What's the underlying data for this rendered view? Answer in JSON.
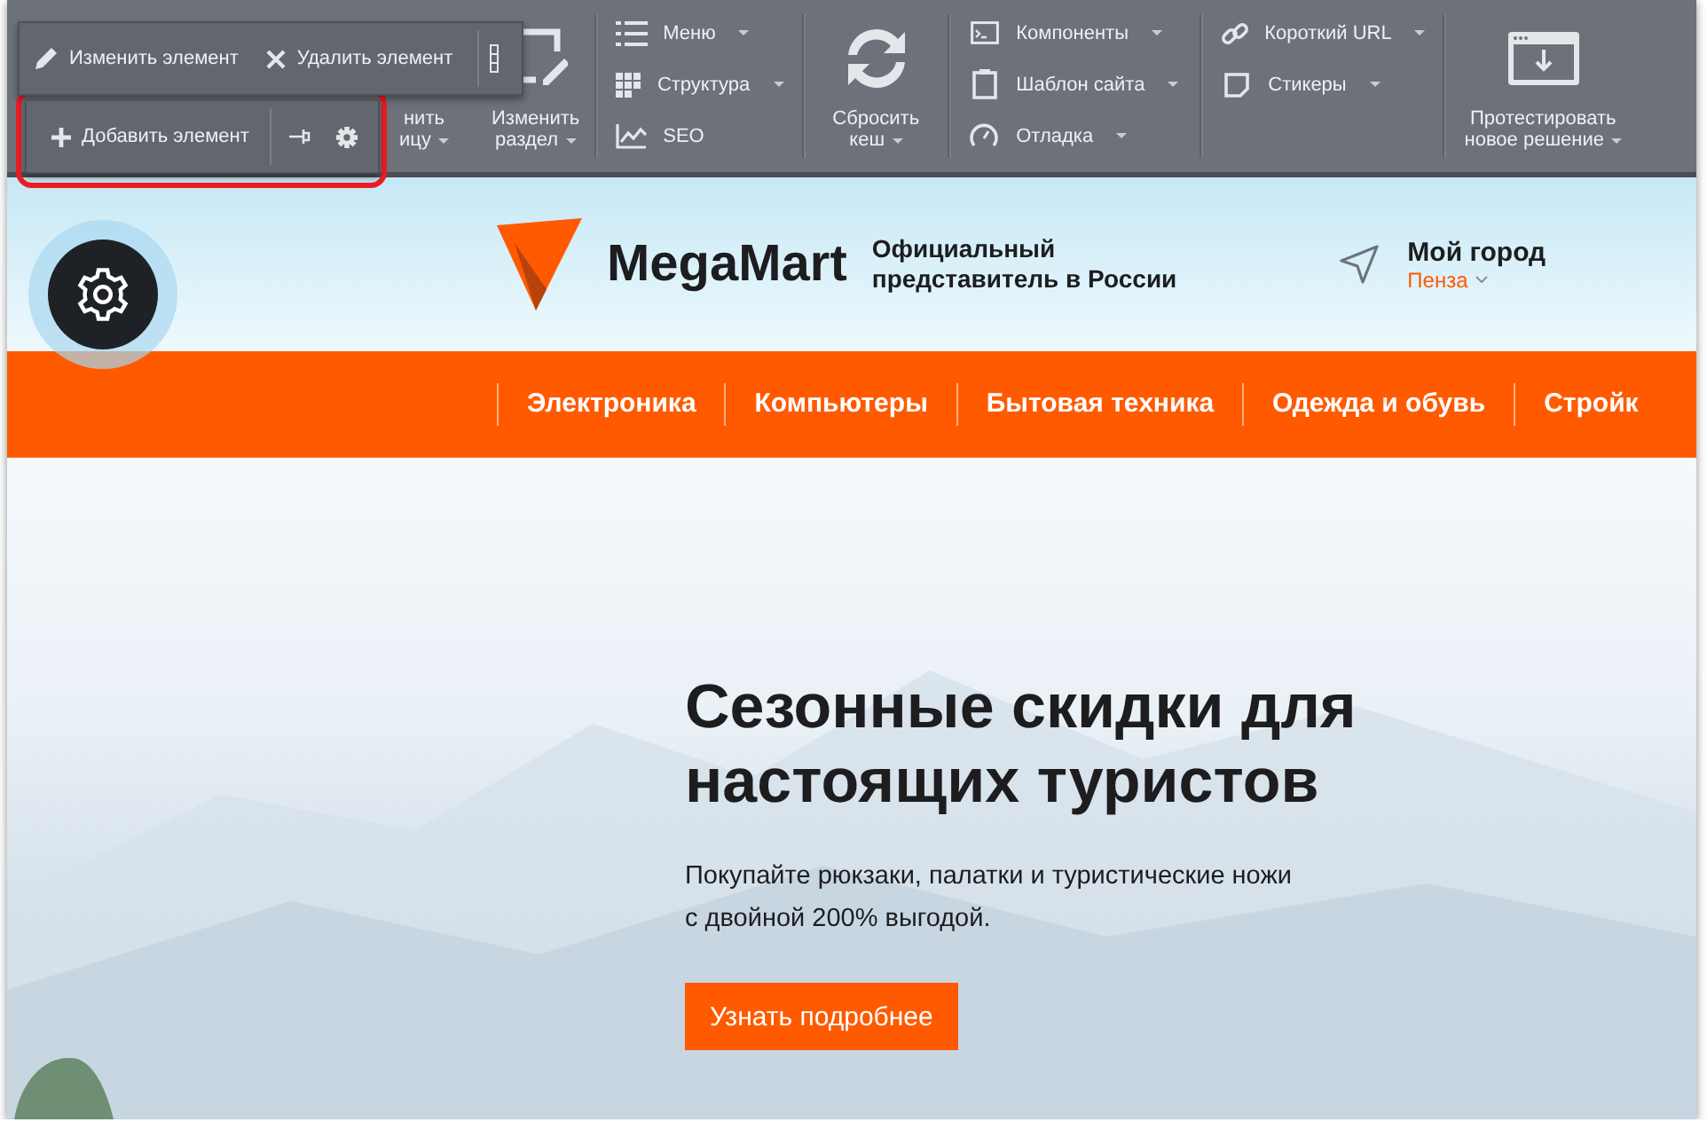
{
  "toolbar": {
    "partial_button": {
      "lines": [
        "нить",
        "ицу"
      ],
      "dropdown": true
    },
    "section_button": {
      "lines": [
        "Изменить",
        "раздел"
      ],
      "dropdown": true
    },
    "menu_group": [
      {
        "label": "Меню",
        "dropdown": true
      },
      {
        "label": "Структура",
        "dropdown": true
      },
      {
        "label": "SEO",
        "dropdown": false
      }
    ],
    "cache_button": {
      "lines": [
        "Сбросить",
        "кеш"
      ],
      "dropdown": true
    },
    "components_group": [
      {
        "label": "Компоненты",
        "dropdown": true
      },
      {
        "label": "Шаблон сайта",
        "dropdown": true
      },
      {
        "label": "Отладка",
        "dropdown": true
      }
    ],
    "url_group": [
      {
        "label": "Короткий URL",
        "dropdown": true
      },
      {
        "label": "Стикеры",
        "dropdown": true
      }
    ],
    "test_button": {
      "lines": [
        "Протестировать",
        "новое решение"
      ],
      "dropdown": true
    }
  },
  "edit_panel": {
    "buttons": [
      {
        "label": "Изменить элемент"
      },
      {
        "label": "Удалить элемент"
      }
    ]
  },
  "add_panel": {
    "label": "Добавить элемент",
    "highlighted": true
  },
  "header": {
    "logo": "MegaMart",
    "tagline_lines": [
      "Официальный",
      "представитель в России"
    ],
    "city_label": "Мой город",
    "city": "Пенза"
  },
  "nav": [
    {
      "label": "Электроника"
    },
    {
      "label": "Компьютеры"
    },
    {
      "label": "Бытовая техника"
    },
    {
      "label": "Одежда и обувь"
    },
    {
      "label": "Стройк"
    }
  ],
  "hero": {
    "title_lines": [
      "Сезонные скидки для",
      "настоящих туристов"
    ],
    "text_lines": [
      "Покупайте рюкзаки, палатки и туристические ножи",
      "с  двойной 200% выгодой."
    ],
    "button": "Узнать подробнее"
  }
}
